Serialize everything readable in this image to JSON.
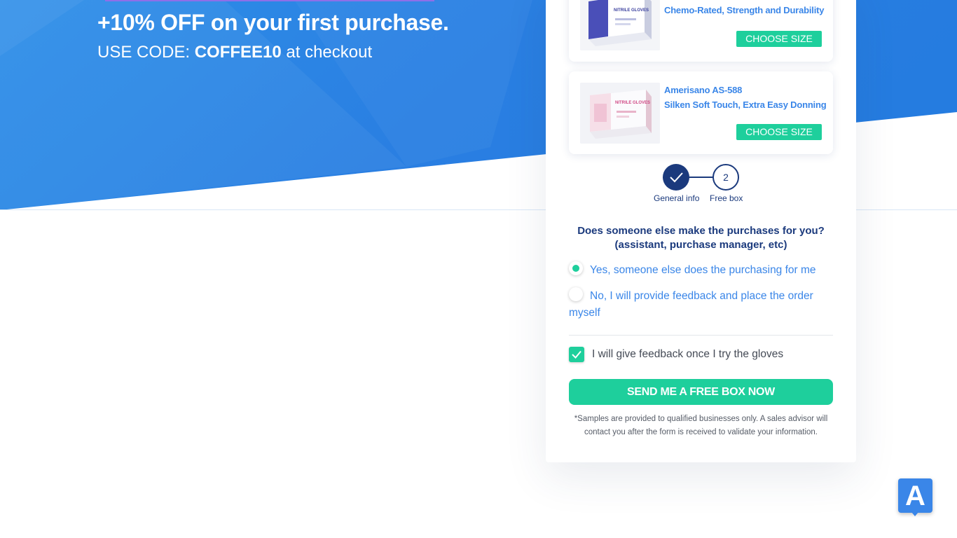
{
  "promo": {
    "title": "+10% OFF on your first purchase.",
    "code_prefix": "USE CODE: ",
    "code": "COFFEE10",
    "code_suffix": " at checkout"
  },
  "products": [
    {
      "description": "Chemo-Rated, Strength and Durability",
      "package_label": "NITRILE GLOVES",
      "button_label": "CHOOSE SIZE"
    },
    {
      "name": "Amerisano AS-588",
      "description": "Silken Soft Touch, Extra Easy Donning",
      "package_label": "NITRILE GLOVES",
      "button_label": "CHOOSE SIZE"
    }
  ],
  "steps": [
    {
      "label": "General info",
      "status": "complete"
    },
    {
      "label": "Free box",
      "number": "2",
      "status": "current"
    }
  ],
  "form": {
    "question": "Does someone else make the purchases for you? (assistant, purchase manager, etc)",
    "options": [
      {
        "label": "Yes, someone else does the purchasing for me",
        "selected": true
      },
      {
        "label": "No, I will provide feedback and place the order myself",
        "selected": false
      }
    ],
    "feedback_checkbox": {
      "label": "I will give feedback once I try the gloves",
      "checked": true
    },
    "submit_label": "SEND ME A FREE BOX NOW",
    "disclaimer": "*Samples are provided to qualified businesses only. A sales advisor will contact you after the form is received to validate your information."
  },
  "chat_widget": {
    "letter": "A"
  },
  "colors": {
    "hero_blue": "#2f8be6",
    "accent_green": "#1ecf9c",
    "navy": "#1b3a7d",
    "link_blue": "#3a86e8"
  }
}
